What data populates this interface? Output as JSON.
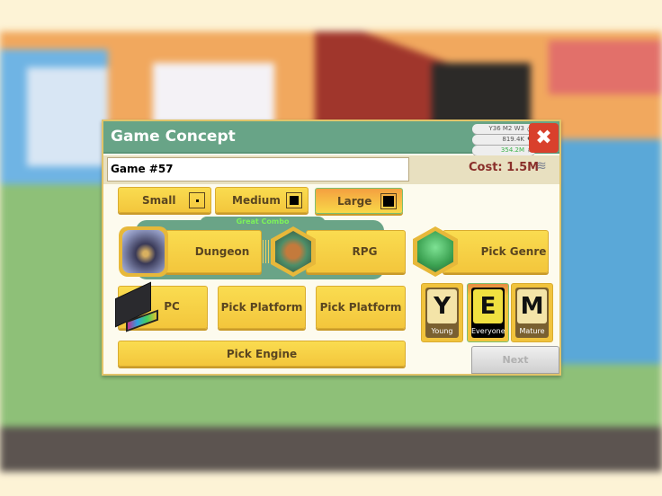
{
  "header": {
    "title": "Game Concept",
    "date": "Y36 M2 W3",
    "fans": "819.4K",
    "money": "354.2M",
    "close_icon": "close-x-icon"
  },
  "name_field": {
    "value": "Game #57"
  },
  "cost": {
    "label": "Cost: 1.5M",
    "icon": "coins-icon"
  },
  "sizes": [
    {
      "label": "Small",
      "selected": false
    },
    {
      "label": "Medium",
      "selected": false
    },
    {
      "label": "Large",
      "selected": true
    }
  ],
  "combo_label": "Great Combo",
  "topic": {
    "label": "Dungeon"
  },
  "genre1": {
    "label": "RPG"
  },
  "genre2": {
    "label": "Pick Genre"
  },
  "platforms": [
    {
      "label": "PC"
    },
    {
      "label": "Pick Platform"
    },
    {
      "label": "Pick Platform"
    }
  ],
  "engine": {
    "label": "Pick Engine"
  },
  "ratings": [
    {
      "letter": "Y",
      "label": "Young",
      "selected": false
    },
    {
      "letter": "E",
      "label": "Everyone",
      "selected": true
    },
    {
      "letter": "M",
      "label": "Mature",
      "selected": false
    }
  ],
  "next": {
    "label": "Next",
    "enabled": false
  },
  "colors": {
    "header": "#68a487",
    "button": "#f6cd42",
    "close": "#d9402c",
    "combo": "#6aa487"
  }
}
